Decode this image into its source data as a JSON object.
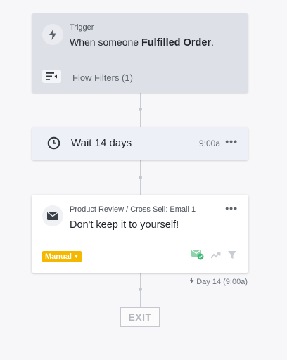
{
  "trigger": {
    "label": "Trigger",
    "text_prefix": "When someone ",
    "event": "Fulfilled Order",
    "text_suffix": ".",
    "icon": "lightning-bolt-icon",
    "filters_label": "Flow Filters (1)",
    "filters_icon": "flow-filter-icon"
  },
  "wait": {
    "label": "Wait 14 days",
    "time": "9:00a",
    "icon": "clock-icon",
    "menu_icon": "more-horizontal-icon"
  },
  "email": {
    "name": "Product Review / Cross Sell: Email 1",
    "subject": "Don't keep it to yourself!",
    "icon": "envelope-icon",
    "badge": "Manual",
    "badge_color": "#f5b800",
    "status_icon_color": "#3cb877"
  },
  "schedule": {
    "label": "Day 14 (9:00a)",
    "icon": "lightning-bolt-icon"
  },
  "exit": {
    "label": "EXIT"
  }
}
